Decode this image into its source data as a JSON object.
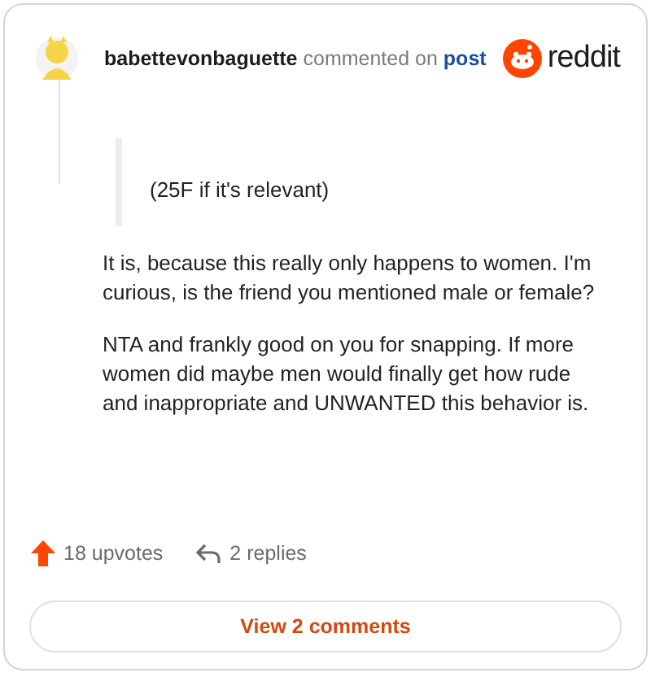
{
  "comment": {
    "author": "babettevonbaguette",
    "action": "commented on",
    "link": "post",
    "brand": "reddit",
    "quote": "(25F if it's relevant)",
    "paragraphs": [
      "It is, because this really only happens to women. I'm curious, is the friend you mentioned male or female?",
      "NTA and frankly good on you for snapping. If more women did maybe men would finally get how rude and inappropriate and UNWANTED this behavior is."
    ],
    "upvotes": "18 upvotes",
    "replies": "2 replies",
    "view_button": "View 2 comments"
  }
}
